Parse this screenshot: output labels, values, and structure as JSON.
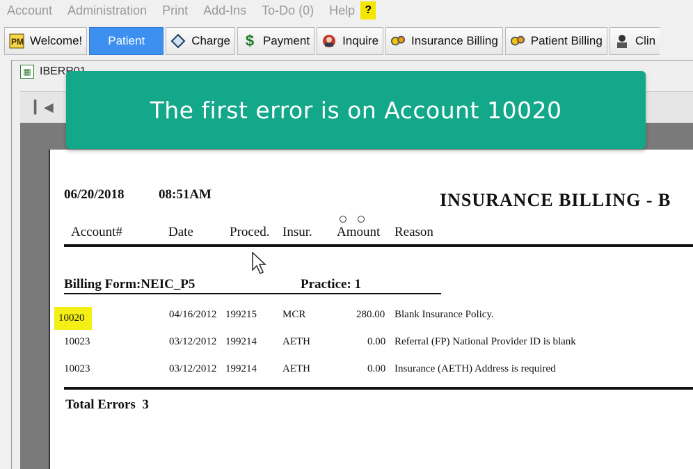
{
  "menubar": {
    "items": [
      "Account",
      "Administration",
      "Print",
      "Add-Ins",
      "To-Do (0)",
      "Help"
    ],
    "help_badge": "?"
  },
  "toolbar": {
    "buttons": [
      {
        "label": "Welcome!",
        "icon": "pm-logo-icon"
      },
      {
        "label": "Patient",
        "icon": ""
      },
      {
        "label": "Charge",
        "icon": "diamond-icon"
      },
      {
        "label": "Payment",
        "icon": "dollar-icon"
      },
      {
        "label": "Inquire",
        "icon": "inquire-icon"
      },
      {
        "label": "Insurance Billing",
        "icon": "gears-icon"
      },
      {
        "label": "Patient Billing",
        "icon": "gears-icon"
      },
      {
        "label": "Clin",
        "icon": "clinician-icon"
      }
    ]
  },
  "window": {
    "title": "IBERR01"
  },
  "callout": {
    "text": "The first error is on Account 10020",
    "color": "#13a88a"
  },
  "report": {
    "date": "06/20/2018",
    "time": "08:51AM",
    "title": "INSURANCE BILLING - B",
    "columns": [
      "Account#",
      "Date",
      "Proced.",
      "Insur.",
      "Amount",
      "Reason"
    ],
    "billing_form": "Billing Form:NEIC_P5",
    "practice": "Practice:  1",
    "rows": [
      {
        "account": "10020",
        "date": "04/16/2012",
        "proced": "199215",
        "insur": "MCR",
        "amount": "280.00",
        "reason": "Blank Insurance Policy."
      },
      {
        "account": "10023",
        "date": "03/12/2012",
        "proced": "199214",
        "insur": "AETH",
        "amount": "0.00",
        "reason": "Referral (FP) National Provider ID is blank"
      },
      {
        "account": "10023",
        "date": "03/12/2012",
        "proced": "199214",
        "insur": "AETH",
        "amount": "0.00",
        "reason": "Insurance (AETH) Address is required"
      }
    ],
    "total_label": "Total Errors",
    "total_value": "3",
    "highlight_color": "#f4ef14"
  }
}
